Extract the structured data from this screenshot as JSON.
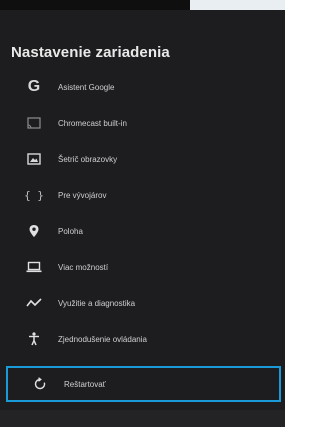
{
  "header": {
    "title": "Nastavenie zariadenia"
  },
  "menu": {
    "items": [
      {
        "label": "Asistent Google",
        "icon": "google-g-icon"
      },
      {
        "label": "Chromecast built-in",
        "icon": "cast-icon"
      },
      {
        "label": "Šetrič obrazovky",
        "icon": "screensaver-icon"
      },
      {
        "label": "Pre vývojárov",
        "icon": "braces-icon"
      },
      {
        "label": "Poloha",
        "icon": "location-pin-icon"
      },
      {
        "label": "Viac možností",
        "icon": "laptop-icon"
      },
      {
        "label": "Využitie a diagnostika",
        "icon": "trend-icon"
      },
      {
        "label": "Zjednodušenie ovládania",
        "icon": "accessibility-icon"
      },
      {
        "label": "Reštartovať",
        "icon": "restart-icon",
        "selected": true
      }
    ]
  },
  "colors": {
    "background": "#1d1d1f",
    "text": "#cfcfd2",
    "focus": "#1a9ad6"
  }
}
